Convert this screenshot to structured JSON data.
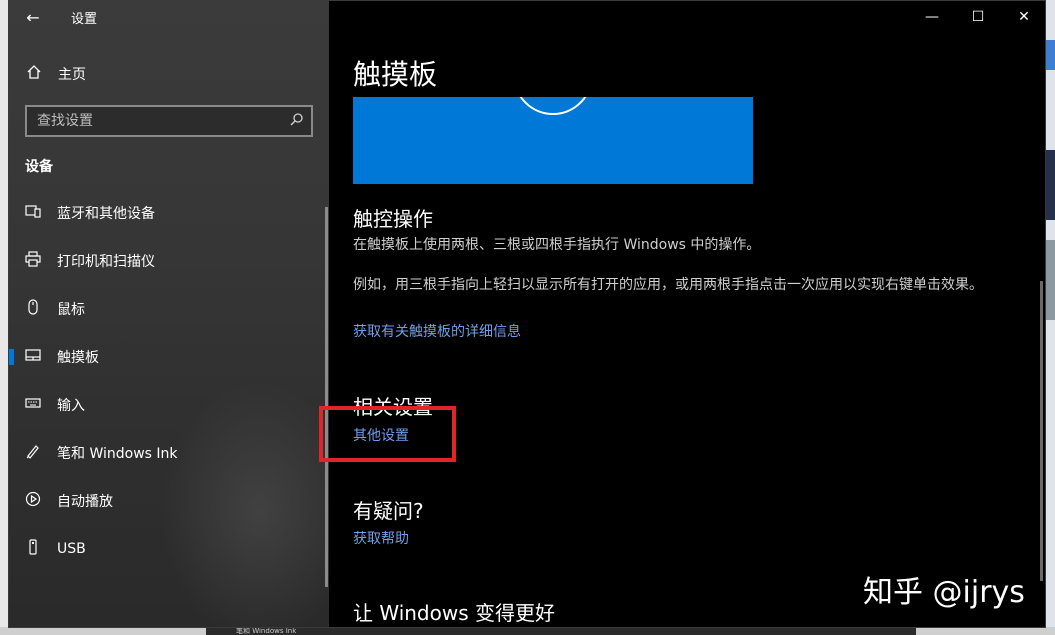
{
  "window": {
    "title": "设置",
    "controls": {
      "minimize": "—",
      "maximize": "☐",
      "close": "✕"
    }
  },
  "sidebar": {
    "back_icon": "back-arrow-icon",
    "home": {
      "label": "主页",
      "icon": "home-icon"
    },
    "search": {
      "placeholder": "查找设置",
      "icon": "search-icon"
    },
    "section": "设备",
    "items": [
      {
        "label": "蓝牙和其他设备",
        "icon": "bluetooth-devices-icon",
        "active": false
      },
      {
        "label": "打印机和扫描仪",
        "icon": "printer-icon",
        "active": false
      },
      {
        "label": "鼠标",
        "icon": "mouse-icon",
        "active": false
      },
      {
        "label": "触摸板",
        "icon": "touchpad-icon",
        "active": true
      },
      {
        "label": "输入",
        "icon": "keyboard-icon",
        "active": false
      },
      {
        "label": "笔和 Windows Ink",
        "icon": "pen-icon",
        "active": false
      },
      {
        "label": "自动播放",
        "icon": "autoplay-icon",
        "active": false
      },
      {
        "label": "USB",
        "icon": "usb-icon",
        "active": false
      }
    ]
  },
  "main": {
    "page_title": "触摸板",
    "accent_color": "#0078d7",
    "touch_ops": {
      "heading": "触控操作",
      "desc": "在触摸板上使用两根、三根或四根手指执行 Windows 中的操作。",
      "example": "例如，用三根手指向上轻扫以显示所有打开的应用，或用两根手指点击一次应用以实现右键单击效果。",
      "link": "获取有关触摸板的详细信息"
    },
    "related": {
      "heading": "相关设置",
      "link": "其他设置"
    },
    "questions": {
      "heading": "有疑问?",
      "link": "获取帮助"
    },
    "improve": {
      "heading": "让 Windows 变得更好"
    }
  },
  "watermark": "知乎 @ijrys",
  "taskbar_peek": "笔和 Windows Ink"
}
